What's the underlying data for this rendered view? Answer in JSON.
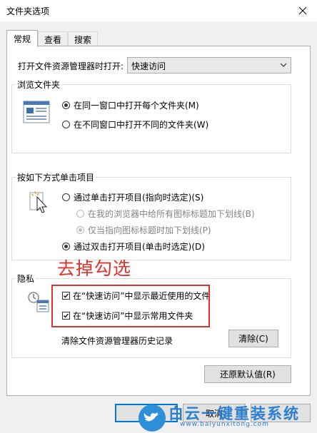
{
  "window": {
    "title": "文件夹选项"
  },
  "tabs": [
    {
      "label": "常规"
    },
    {
      "label": "查看"
    },
    {
      "label": "搜索"
    }
  ],
  "open_explorer": {
    "label": "打开文件资源管理器时打开:",
    "value": "快速访问"
  },
  "browse_folders": {
    "label": "浏览文件夹",
    "options": [
      {
        "label": "在同一窗口中打开每个文件夹(M)",
        "checked": true
      },
      {
        "label": "在不同窗口中打开不同的文件夹(W)",
        "checked": false
      }
    ]
  },
  "click_items": {
    "label": "按如下方式单击项目",
    "single": {
      "label": "通过单击打开项目(指向时选定)(S)",
      "checked": false
    },
    "underline_all": {
      "label": "在我的浏览器中给所有图标标题加下划线(B)",
      "checked": false,
      "disabled": true
    },
    "underline_point": {
      "label": "仅当指向图标标题时加下划线(P)",
      "checked": true,
      "disabled": true
    },
    "double": {
      "label": "通过双击打开项目(单击时选定)(D)",
      "checked": true
    }
  },
  "privacy": {
    "label": "隐私",
    "show_recent": {
      "label": "在“快速访问”中显示最近使用的文件",
      "checked": true
    },
    "show_frequent": {
      "label": "在“快速访问”中显示常用文件夹",
      "checked": true
    },
    "clear_label": "清除文件资源管理器历史记录",
    "clear_button": "清除(C)"
  },
  "annotation": {
    "text": "去掉勾选",
    "color": "#e0322b"
  },
  "restore_button": "还原默认值(R)",
  "footer": {
    "cancel_button": "取消"
  },
  "watermark": {
    "brand": "白云一键重装系统",
    "url": "www.baiyunxitong.com"
  },
  "colors": {
    "accent": "#2a7fd0",
    "highlight": "#e0322b"
  }
}
